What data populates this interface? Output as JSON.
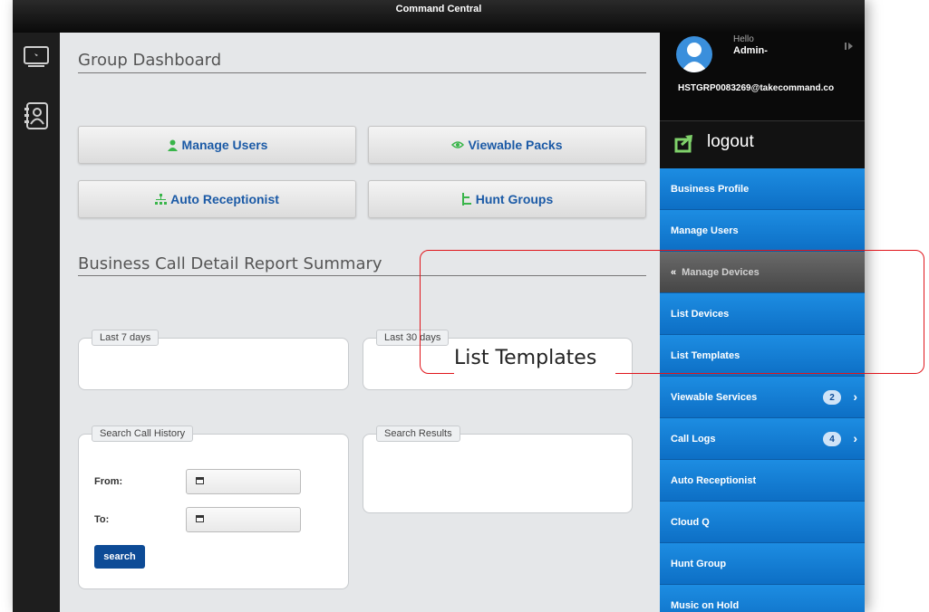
{
  "window": {
    "title": "Command Central"
  },
  "main": {
    "dashboard_title": "Group Dashboard",
    "buttons": {
      "manage_users": "Manage Users",
      "viewable_packs": "Viewable Packs",
      "auto_receptionist": "Auto Receptionist",
      "hunt_groups": "Hunt Groups"
    },
    "report_title": "Business Call Detail Report Summary",
    "panels": {
      "last7": "Last 7 days",
      "last30": "Last 30 days",
      "search_history": "Search Call History",
      "search_results": "Search Results"
    },
    "form": {
      "from_label": "From:",
      "to_label": "To:",
      "search_label": "search"
    }
  },
  "sidebar": {
    "greeting": "Hello",
    "user": "Admin-",
    "email": "HSTGRP0083269@takecommand.co",
    "logout_label": "logout",
    "items": [
      {
        "label": "Business Profile"
      },
      {
        "label": "Manage Users"
      },
      {
        "label": "Manage Devices",
        "prefix": "«"
      },
      {
        "label": "List Devices"
      },
      {
        "label": "List Templates"
      },
      {
        "label": "Viewable Services",
        "badge": "2"
      },
      {
        "label": "Call Logs",
        "badge": "4"
      },
      {
        "label": "Auto Receptionist"
      },
      {
        "label": "Cloud Q"
      },
      {
        "label": "Hunt Group"
      },
      {
        "label": "Music on Hold"
      }
    ]
  },
  "callout": {
    "label": "List Templates"
  },
  "colors": {
    "brand_blue": "#1b5aa6",
    "sidebar_blue": "#1d8de2",
    "callout_red": "#e0151b",
    "icon_green": "#39b54a"
  },
  "icons": [
    "desktop-icon",
    "contacts-icon",
    "user-icon",
    "eye-icon",
    "org-chart-icon",
    "hunt-icon",
    "calendar-icon",
    "logout-icon",
    "collapse-icon"
  ]
}
